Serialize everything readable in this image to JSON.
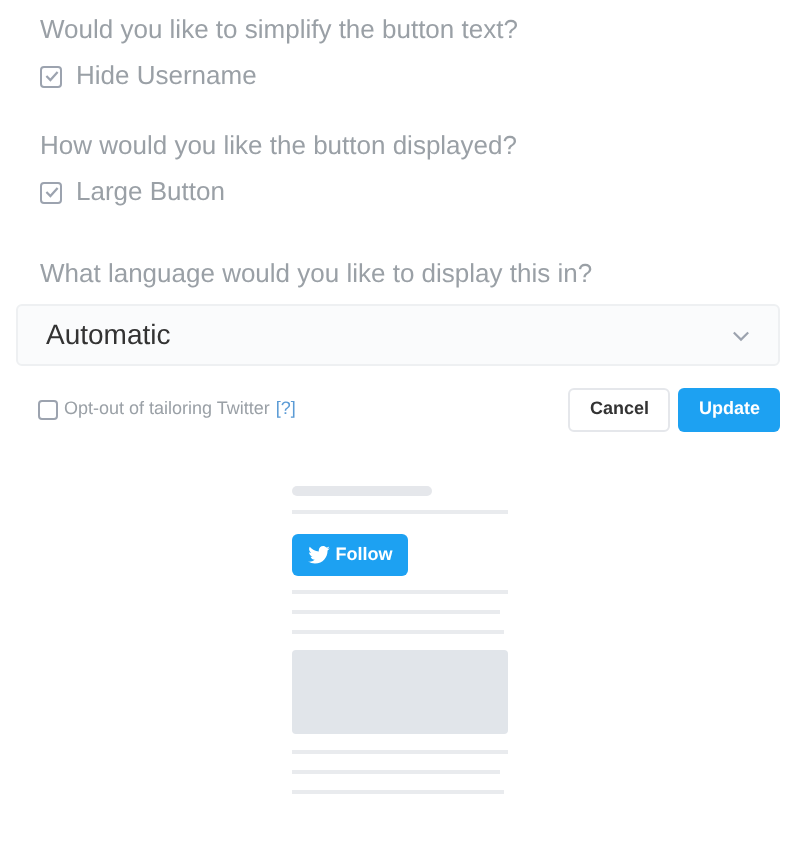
{
  "options": [
    {
      "question": "Would you like to simplify the button text?",
      "label": "Hide Username",
      "checked": true
    },
    {
      "question": "How would you like the button displayed?",
      "label": "Large Button",
      "checked": true
    }
  ],
  "language": {
    "question": "What language would you like to display this in?",
    "value": "Automatic"
  },
  "opt_out": {
    "label": "Opt-out of tailoring Twitter",
    "help": "[?]",
    "checked": false
  },
  "buttons": [
    {
      "label": "Cancel",
      "kind": "secondary"
    },
    {
      "label": "Update",
      "kind": "primary"
    }
  ],
  "preview": {
    "button": "Follow"
  }
}
